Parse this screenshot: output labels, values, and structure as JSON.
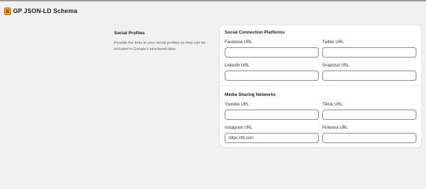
{
  "app": {
    "title": "GP JSON-LD Schema",
    "icon": "app-logo-icon"
  },
  "section": {
    "title": "Social Profiles",
    "description": "Provide the links to your social profiles so they can be included in Google's structured data."
  },
  "groups": [
    {
      "title": "Social Connection Platforms",
      "fields": [
        {
          "label": "Facebook URL",
          "value": ""
        },
        {
          "label": "Twitter URL",
          "value": ""
        },
        {
          "label": "Linkedin URL",
          "value": ""
        },
        {
          "label": "Snapchat URL",
          "value": ""
        }
      ]
    },
    {
      "title": "Media Sharing Networks",
      "fields": [
        {
          "label": "Youtube URL",
          "value": ""
        },
        {
          "label": "Tiktok URL",
          "value": ""
        },
        {
          "label": "Instagram URL",
          "value": "https://fb.com"
        },
        {
          "label": "Pinterest URL",
          "value": ""
        }
      ]
    }
  ]
}
